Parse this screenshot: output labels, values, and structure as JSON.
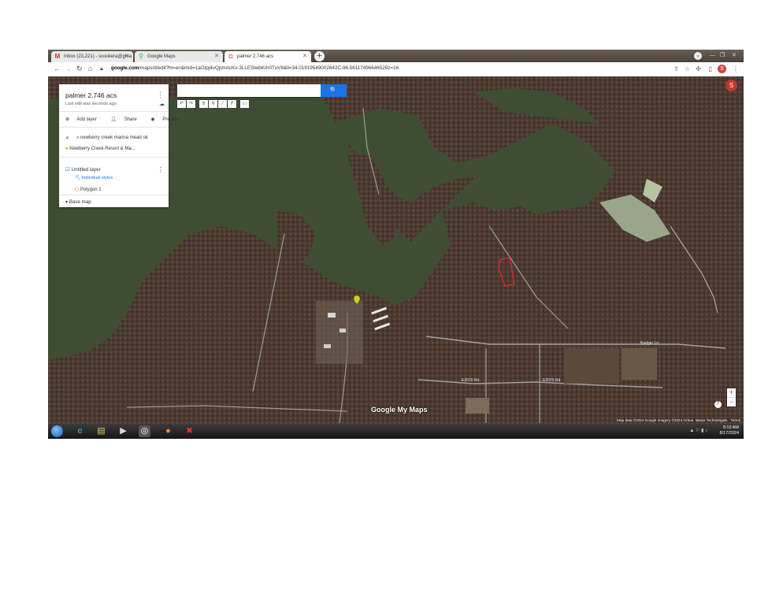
{
  "browser": {
    "tabs": [
      {
        "label": "Inbox (23,221) - scookera@gma",
        "icon": "gmail-icon"
      },
      {
        "label": "Google Maps",
        "icon": "maps-pin-icon"
      },
      {
        "label": "palmer 2.746 acs",
        "icon": "mymaps-icon",
        "active": true
      }
    ],
    "new_tab": "+",
    "url_host": "google.com",
    "url_path": "/maps/d/edit?hl=en&mid=1aGtpj4vQpmAcKx-3LLESlwbKrh0TuV8&ll=34.01919549002642C-96.56117496646528z=16",
    "profile_initial": "S"
  },
  "map": {
    "search_button": "🔍",
    "account_initial": "S",
    "zoom_in": "+",
    "zoom_out": "−",
    "help": "?",
    "attribution": "Map data ©2024 Google Imagery ©2024 Airbus, Maxar Technologies · Terms",
    "google_logo": "Google My Maps",
    "road_labels": [
      "E2070 Rd",
      "E2070 Rd",
      "Badger Ln"
    ]
  },
  "panel": {
    "title": "palmer 2.746 acs",
    "subtitle": "Last edit was seconds ago",
    "add_layer": "Add layer",
    "share": "Share",
    "preview": "Preview",
    "search_result": "newberry creek marina mead ok",
    "place": "Newberry Creek Resort & Ma...",
    "layer_name": "Untitled layer",
    "layer_style": "Individual styles",
    "polygon": "Polygon 1",
    "base_map": "Base map"
  },
  "taskbar": {
    "time": "9:10 AM",
    "date": "8/17/2024"
  },
  "colors": {
    "water": "#3f4d33",
    "forest": "#4a3930",
    "accent": "#1a73e8",
    "polygon": "#e02a2a"
  }
}
